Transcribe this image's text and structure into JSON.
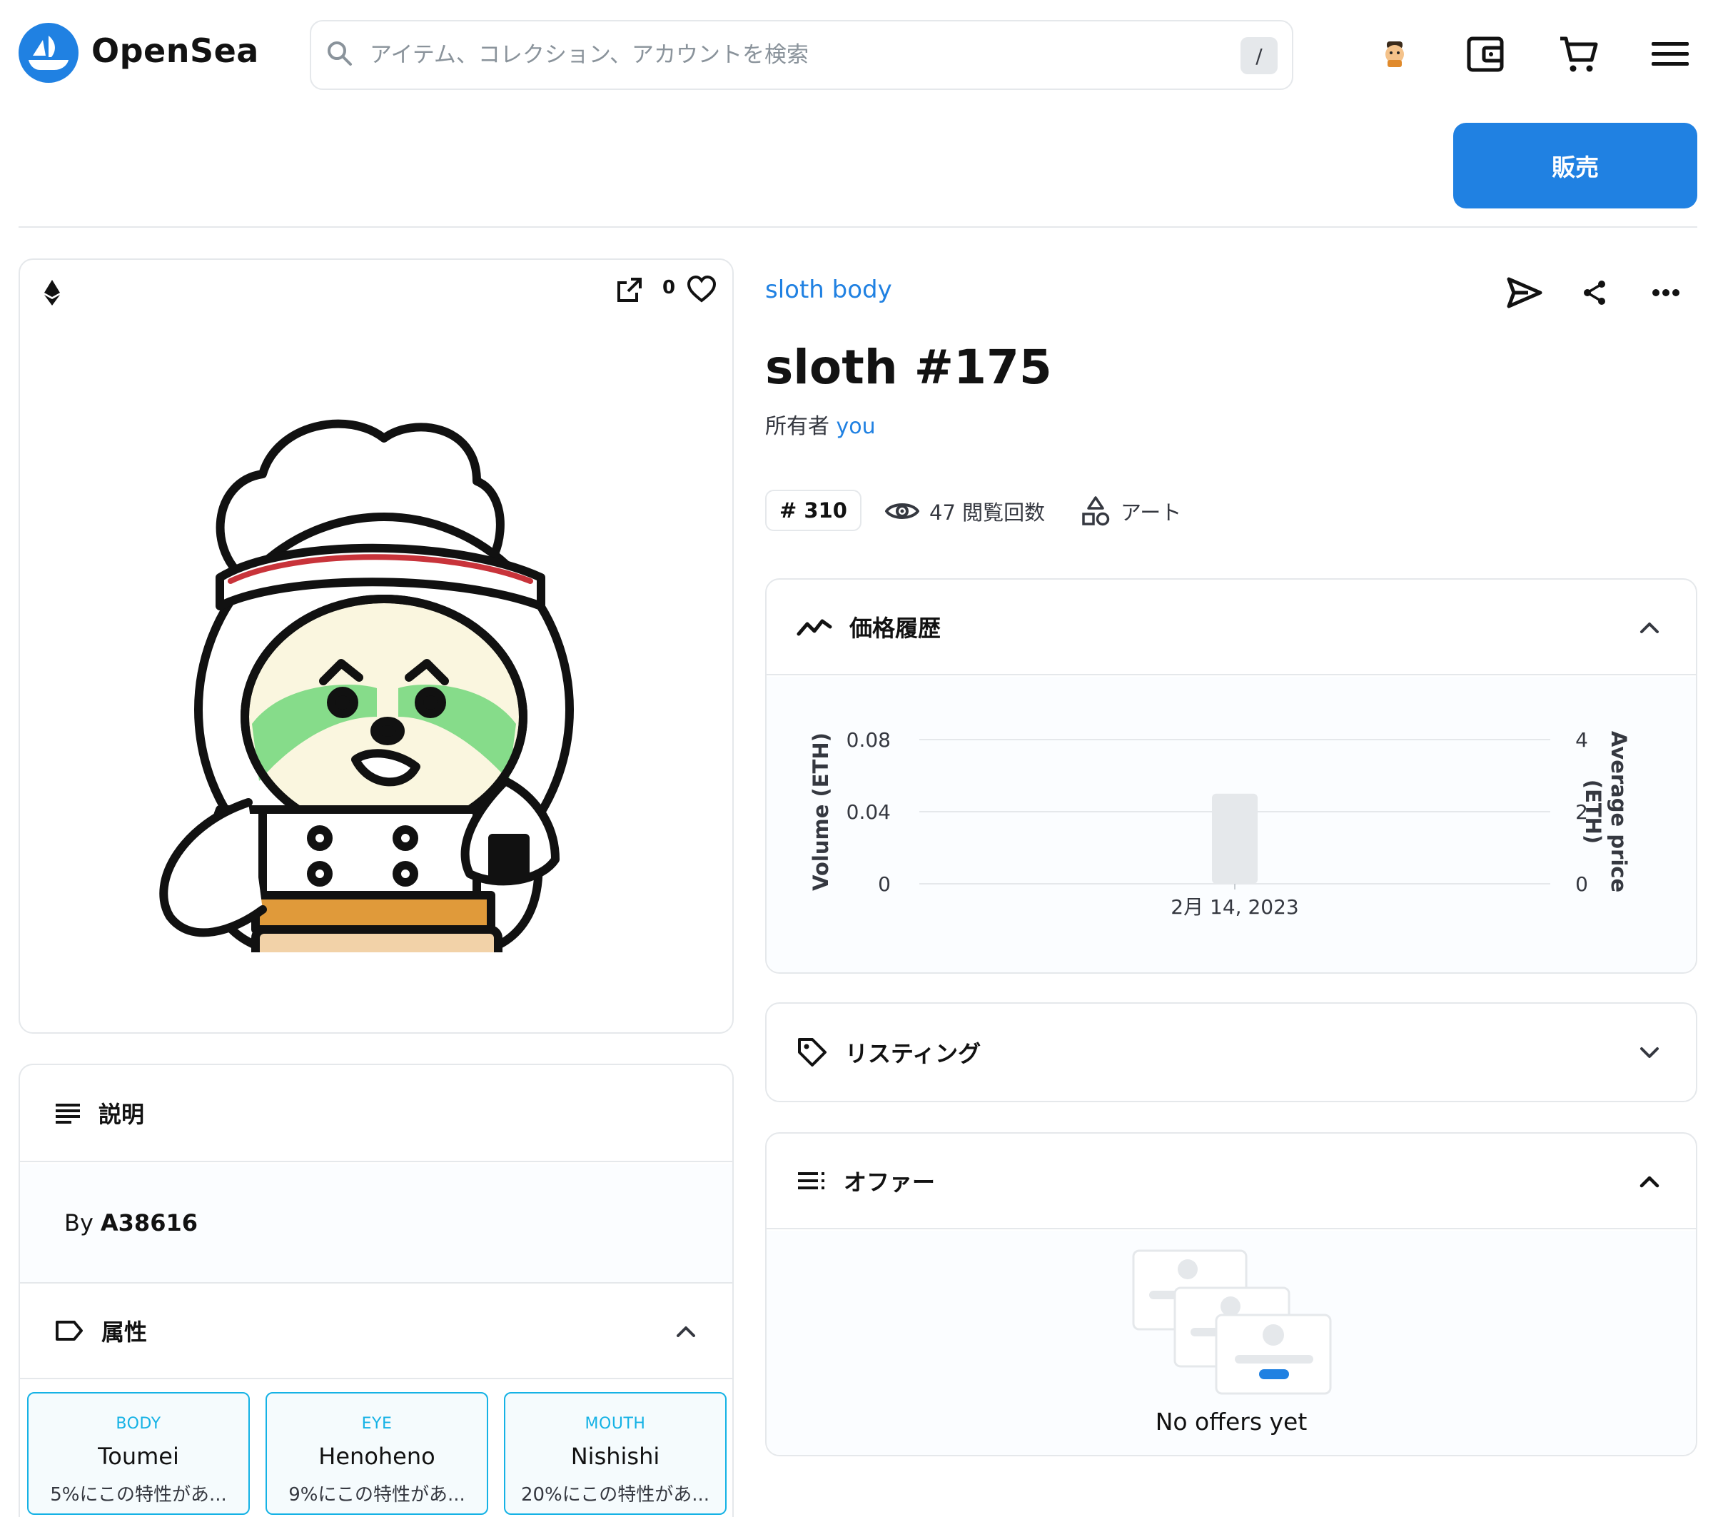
{
  "header": {
    "brand": "OpenSea",
    "search_placeholder": "アイテム、コレクション、アカウントを検索",
    "search_shortcut": "/",
    "sell_label": "販売"
  },
  "item_card": {
    "like_count": "0"
  },
  "description": {
    "heading": "説明",
    "by_prefix": "By",
    "creator": "A38616"
  },
  "attributes": {
    "heading": "属性",
    "traits": [
      {
        "type": "BODY",
        "value": "Toumei",
        "rarity": "5%にこの特性があ..."
      },
      {
        "type": "EYE",
        "value": "Henoheno",
        "rarity": "9%にこの特性があ..."
      },
      {
        "type": "MOUTH",
        "value": "Nishishi",
        "rarity": "20%にこの特性があ..."
      }
    ]
  },
  "item": {
    "collection": "sloth body",
    "title": "sloth #175",
    "owner_label": "所有者",
    "owner": "you",
    "rank": "# 310",
    "views": "47 閲覧回数",
    "category": "アート"
  },
  "price_history": {
    "heading": "価格履歴"
  },
  "listing": {
    "heading": "リスティング"
  },
  "offers": {
    "heading": "オファー",
    "empty_text": "No offers yet"
  },
  "chart_data": {
    "type": "bar",
    "categories": [
      "2月 14, 2023"
    ],
    "series": [
      {
        "values": [
          0.05
        ]
      }
    ],
    "ylabel": "Volume (ETH)",
    "y2label": "Average price (ETH)",
    "ylim": [
      0,
      0.08
    ],
    "y2lim": [
      0,
      4
    ],
    "yticks": [
      "0",
      "0.04",
      "0.08"
    ],
    "y2ticks": [
      "0",
      "2",
      "4"
    ],
    "grid": true,
    "bar_color": "#e5e8eb"
  },
  "colors": {
    "accent": "#2081e2",
    "trait_accent": "#15b2e5",
    "border": "#e5e8eb"
  }
}
